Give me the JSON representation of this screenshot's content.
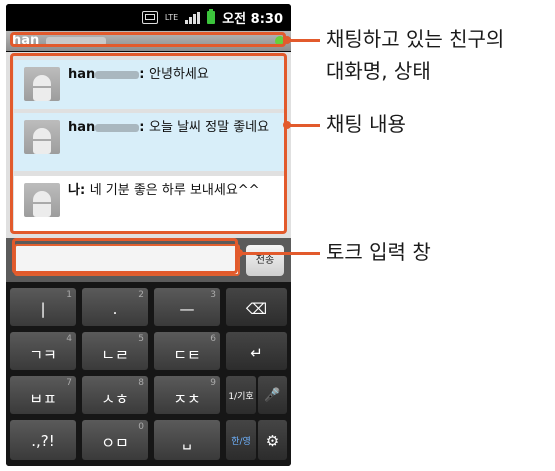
{
  "status_bar": {
    "network": "LTE",
    "time": "오전 8:30"
  },
  "titlebar": {
    "name": "han"
  },
  "messages": [
    {
      "sender": "han",
      "separator": ": ",
      "text": "안녕하세요",
      "sender_masked": true
    },
    {
      "sender": "han",
      "separator": ": ",
      "text": "오늘 날씨 정말 좋네요",
      "sender_masked": true
    },
    {
      "sender": "나",
      "separator": ": ",
      "text": "네 기분 좋은 하루 보내세요^^",
      "sender_masked": false
    }
  ],
  "input": {
    "value": "",
    "send_label": "전송"
  },
  "keyboard": {
    "rows": [
      [
        {
          "main": "|",
          "sup": "1"
        },
        {
          "main": ".",
          "sup": "2"
        },
        {
          "main": "—",
          "sup": "3"
        },
        {
          "main": "⌫",
          "sup": ""
        }
      ],
      [
        {
          "main": "ㄱㅋ",
          "sup": "4"
        },
        {
          "main": "ㄴㄹ",
          "sup": "5"
        },
        {
          "main": "ㄷㅌ",
          "sup": "6"
        },
        {
          "main": "↵",
          "sup": ""
        }
      ],
      [
        {
          "main": "ㅂㅍ",
          "sup": "7"
        },
        {
          "main": "ㅅㅎ",
          "sup": "8"
        },
        {
          "main": "ㅈㅊ",
          "sup": "9"
        },
        {
          "main": "1/기호",
          "sup": ""
        },
        {
          "main": "🎤",
          "sup": ""
        }
      ],
      [
        {
          "main": ".,?!",
          "sup": ""
        },
        {
          "main": "ㅇㅁ",
          "sup": "0"
        },
        {
          "main": "␣",
          "sup": ""
        },
        {
          "main": "한/영",
          "sup": ""
        },
        {
          "main": "⚙",
          "sup": ""
        }
      ]
    ]
  },
  "annotations": {
    "title": "채팅하고 있는 친구의 대화명, 상태",
    "title_line1": "채팅하고 있는 친구의",
    "title_line2": "대화명, 상태",
    "chat": "채팅 내용",
    "input": "토크 입력 창"
  },
  "colors": {
    "accent": "#e25a2c",
    "chat_bubble": "#d8eef9",
    "status_online": "#66d13c"
  }
}
